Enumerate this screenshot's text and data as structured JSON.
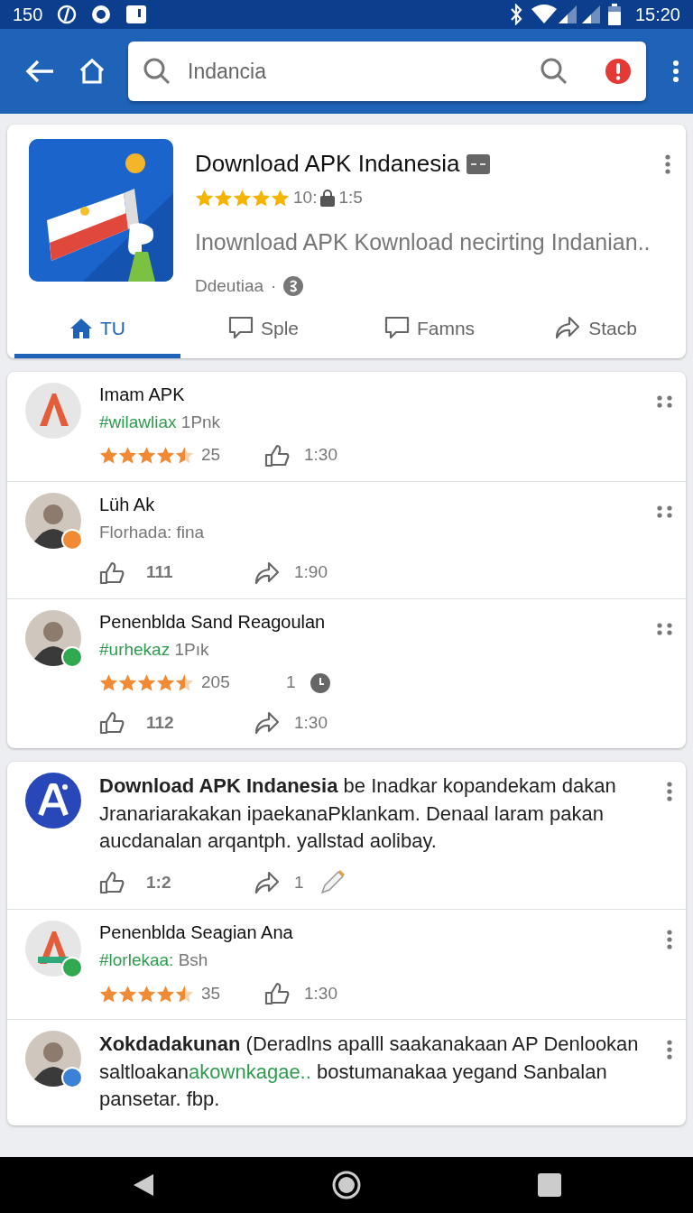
{
  "status_bar": {
    "left_text": "150",
    "time": "15:20"
  },
  "toolbar": {
    "search": {
      "value": "Indancia"
    }
  },
  "app": {
    "title": "Download APK Indanesia",
    "stars": 5,
    "rating": "10:",
    "size": "1:5",
    "description": "Inownload APK Kownload necirting Indanian..",
    "developer": "Ddeutiaa",
    "separator": "·",
    "tabs": [
      {
        "label": "TU",
        "kind": "home",
        "selected": true
      },
      {
        "label": "Sple",
        "kind": "comment",
        "selected": false
      },
      {
        "label": "Famns",
        "kind": "comment",
        "selected": false
      },
      {
        "label": "Stacb",
        "kind": "share",
        "selected": false
      }
    ]
  },
  "feed": [
    {
      "items": [
        {
          "kind": "review",
          "avatar": {
            "kind": "logo"
          },
          "name": "Imam APK",
          "tag": "#wilawliax",
          "note": "1Pnk",
          "stars": 4.5,
          "count": "25",
          "meta": {
            "kind": "thumb",
            "text": "1:30"
          }
        },
        {
          "kind": "comment",
          "avatar": {
            "kind": "photo"
          },
          "badge": {
            "color": "#f08a35"
          },
          "name": "Lüh Ak",
          "subtitle": "Florhada: fina",
          "likes": "111",
          "shares": "1:90"
        },
        {
          "kind": "review",
          "avatar": {
            "kind": "photo"
          },
          "badge": {
            "color": "#2fa84f"
          },
          "name": "Penenblda Sand Reagoulan",
          "tag": "#urhekaz",
          "note": "1Pık",
          "stars": 4.5,
          "count": "205",
          "meta": {
            "kind": "clock",
            "text": "1"
          },
          "likes": "112",
          "shares": "1:30"
        }
      ]
    },
    {
      "items": [
        {
          "kind": "post",
          "avatar": {
            "kind": "letter"
          },
          "text": "**Download APK Indanesia** be Inadkar kopandekam dakan Jranariarakakan ipaekanaPklankam. Denaal laram pakan aucdanalan arqantph. yallstad aolibay.",
          "likes": "1:2",
          "shares": "1"
        },
        {
          "kind": "review",
          "avatar": {
            "kind": "logo"
          },
          "badge": {
            "color": "#2fa84f"
          },
          "name": "Penenblda Seagian Ana",
          "tag": "#lorlekaa:",
          "note": "Bsh",
          "stars": 4.5,
          "count": "35",
          "meta": {
            "kind": "thumb",
            "text": "1:30"
          }
        },
        {
          "kind": "message",
          "avatar": {
            "kind": "photo"
          },
          "badge": {
            "color": "#3b82d6"
          },
          "segments": [
            {
              "kind": "bold",
              "text": "Xokdadakunan"
            },
            {
              "kind": "plain",
              "text": " (Deradlns apalll saakanakaan AP Denlookan saltloakan"
            },
            {
              "kind": "link",
              "text": "akownkagae.."
            },
            {
              "kind": "plain",
              "text": " bostumanakaa yegand Sanbalan pansetar. fbp."
            }
          ]
        }
      ]
    }
  ]
}
